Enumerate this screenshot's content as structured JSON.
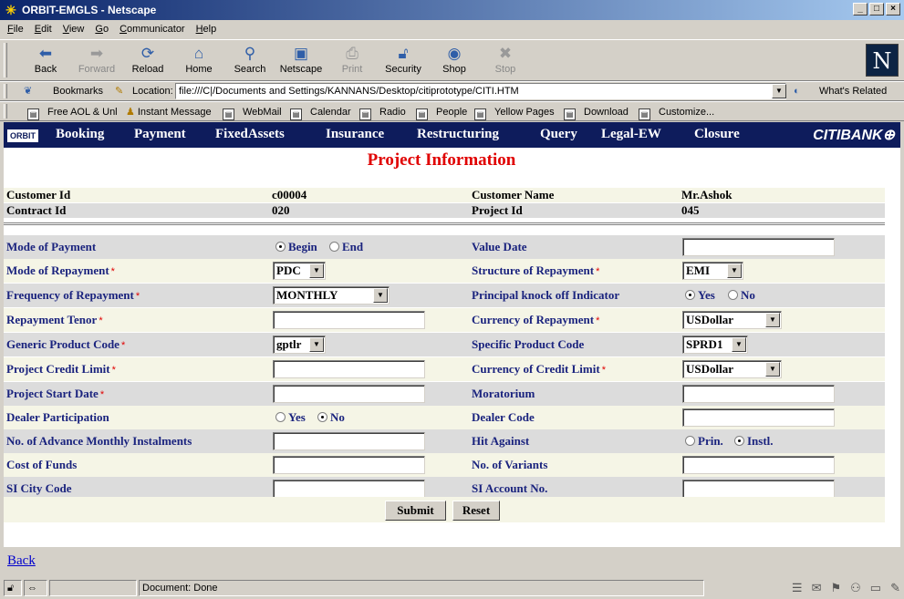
{
  "window": {
    "title": "ORBIT-EMGLS - Netscape"
  },
  "menubar": [
    "File",
    "Edit",
    "View",
    "Go",
    "Communicator",
    "Help"
  ],
  "nav_toolbar": [
    {
      "label": "Back",
      "icon": "back-arrow-icon",
      "enabled": true
    },
    {
      "label": "Forward",
      "icon": "forward-arrow-icon",
      "enabled": false
    },
    {
      "label": "Reload",
      "icon": "reload-icon",
      "enabled": true
    },
    {
      "label": "Home",
      "icon": "home-icon",
      "enabled": true
    },
    {
      "label": "Search",
      "icon": "search-icon",
      "enabled": true
    },
    {
      "label": "Netscape",
      "icon": "netscape-my-icon",
      "enabled": true
    },
    {
      "label": "Print",
      "icon": "print-icon",
      "enabled": false
    },
    {
      "label": "Security",
      "icon": "lock-icon",
      "enabled": true
    },
    {
      "label": "Shop",
      "icon": "shop-icon",
      "enabled": true
    },
    {
      "label": "Stop",
      "icon": "stop-icon",
      "enabled": false
    }
  ],
  "location": {
    "bookmarks_label": "Bookmarks",
    "location_label": "Location:",
    "url": "file:///C|/Documents and Settings/KANNANS/Desktop/citiprototype/CITI.HTM",
    "whats_related": "What's Related"
  },
  "personal_toolbar": [
    "Free AOL & Unl",
    "Instant Message",
    "WebMail",
    "Calendar",
    "Radio",
    "People",
    "Yellow Pages",
    "Download",
    "Customize..."
  ],
  "app_nav": {
    "logo": "ORBIT",
    "items": [
      "Booking",
      "Payment",
      "FixedAssets",
      "Insurance",
      "Restructuring",
      "Query",
      "Legal-EW",
      "Closure"
    ],
    "brand": "CITIBANK"
  },
  "page_title": "Project Information",
  "header": {
    "customer_id_label": "Customer Id",
    "customer_id": "c00004",
    "customer_name_label": "Customer Name",
    "customer_name": "Mr.Ashok",
    "contract_id_label": "Contract Id",
    "contract_id": "020",
    "project_id_label": "Project Id",
    "project_id": "045"
  },
  "form": {
    "mode_of_payment": {
      "label": "Mode of Payment",
      "options": [
        "Begin",
        "End"
      ],
      "selected": "Begin"
    },
    "value_date": {
      "label": "Value Date",
      "value": ""
    },
    "mode_of_repayment": {
      "label": "Mode of Repayment",
      "value": "PDC"
    },
    "structure_of_repayment": {
      "label": "Structure of Repayment",
      "value": "EMI"
    },
    "frequency_of_repayment": {
      "label": "Frequency of Repayment",
      "value": "MONTHLY"
    },
    "principal_knock_off": {
      "label": "Principal knock off Indicator",
      "options": [
        "Yes",
        "No"
      ],
      "selected": "Yes"
    },
    "repayment_tenor": {
      "label": "Repayment Tenor",
      "value": ""
    },
    "currency_of_repayment": {
      "label": "Currency of Repayment",
      "value": "USDollar"
    },
    "generic_product_code": {
      "label": "Generic Product Code",
      "value": "gptlr"
    },
    "specific_product_code": {
      "label": "Specific Product Code",
      "value": "SPRD1"
    },
    "project_credit_limit": {
      "label": "Project Credit Limit",
      "value": ""
    },
    "currency_of_credit_limit": {
      "label": "Currency of Credit Limit",
      "value": "USDollar"
    },
    "project_start_date": {
      "label": "Project Start Date",
      "value": ""
    },
    "moratorium": {
      "label": "Moratorium",
      "value": ""
    },
    "dealer_participation": {
      "label": "Dealer Participation",
      "options": [
        "Yes",
        "No"
      ],
      "selected": "No"
    },
    "dealer_code": {
      "label": "Dealer Code",
      "value": ""
    },
    "advance_instalments": {
      "label": "No. of Advance Monthly Instalments",
      "value": ""
    },
    "hit_against": {
      "label": "Hit Against",
      "options": [
        "Prin.",
        "Instl."
      ],
      "selected": "Instl."
    },
    "cost_of_funds": {
      "label": "Cost of Funds",
      "value": ""
    },
    "no_of_variants": {
      "label": "No. of Variants",
      "value": ""
    },
    "si_city_code": {
      "label": "SI City Code",
      "value": ""
    },
    "si_account_no": {
      "label": "SI Account No.",
      "value": ""
    },
    "required_marker": "*"
  },
  "buttons": {
    "submit": "Submit",
    "reset": "Reset"
  },
  "back_link": "Back",
  "status": {
    "text": "Document: Done"
  },
  "colors": {
    "app_nav_bg": "#0e1c5c",
    "title_red": "#e00000",
    "label_blue": "#1a237e",
    "row_alt": "#dcdcdc",
    "row_light": "#f5f5e6"
  }
}
